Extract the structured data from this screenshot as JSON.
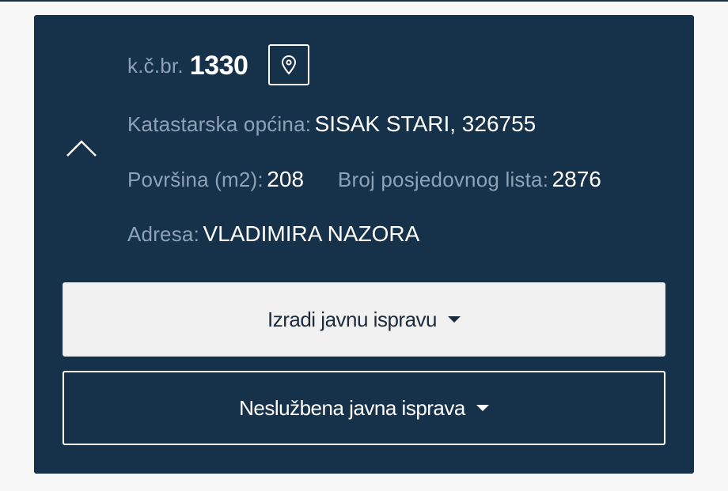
{
  "parcel": {
    "number_label": "k.č.br.",
    "number": "1330",
    "cadastral_municipality_label": "Katastarska općina:",
    "cadastral_municipality": "SISAK STARI, 326755",
    "area_label": "Površina (m2):",
    "area": "208",
    "possession_sheet_label": "Broj posjedovnog lista:",
    "possession_sheet": "2876",
    "address_label": "Adresa:",
    "address": "VLADIMIRA NAZORA"
  },
  "actions": {
    "create_document_label": "Izradi javnu ispravu",
    "unofficial_document_label": "Neslužbena javna isprava"
  },
  "icons": {
    "collapse": "chevron-up-icon",
    "location": "map-pin-icon",
    "dropdown": "caret-down-icon"
  },
  "colors": {
    "card_background": "#16314a",
    "label": "#8ea2b7",
    "value": "#ffffff",
    "primary_button": "#f1f1f2"
  }
}
